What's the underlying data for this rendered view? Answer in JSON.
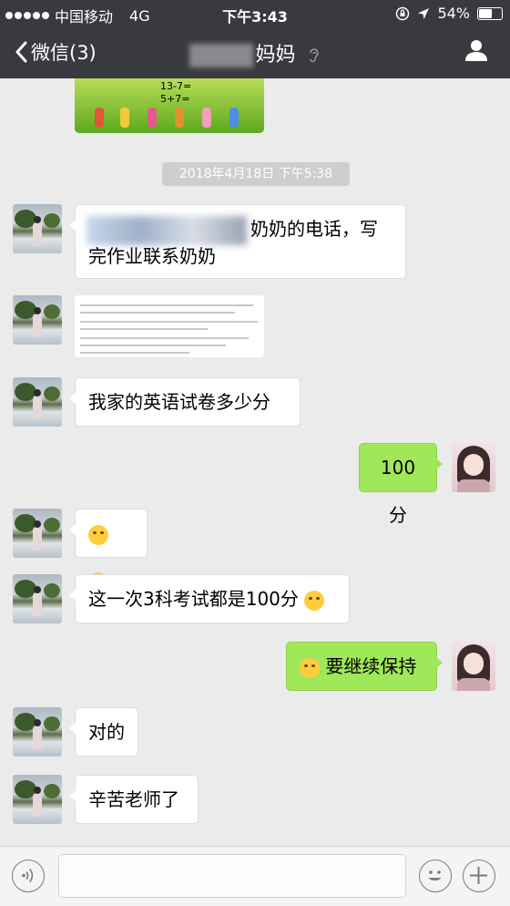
{
  "status_bar": {
    "carrier": "中国移动",
    "network": "4G",
    "time": "下午3:43",
    "battery": "54%",
    "battery_level": 0.54
  },
  "nav": {
    "back_label": "微信(3)",
    "title": "妈妈"
  },
  "chat": {
    "top_image_text": [
      "13-7=",
      "5+7="
    ],
    "timestamp": "2018年4月18日 下午5:38",
    "messages": [
      {
        "text": "奶奶的电话，写",
        "line2": "完作业联系奶奶"
      },
      {
        "text": "我家的英语试卷多少分"
      },
      {
        "text": "100分"
      },
      {
        "text": ""
      },
      {
        "text": "这一次3科考试都是100分"
      },
      {
        "text": "要继续保持"
      },
      {
        "text": "对的"
      },
      {
        "text": "辛苦老师了"
      }
    ]
  },
  "input_bar": {
    "placeholder": ""
  }
}
